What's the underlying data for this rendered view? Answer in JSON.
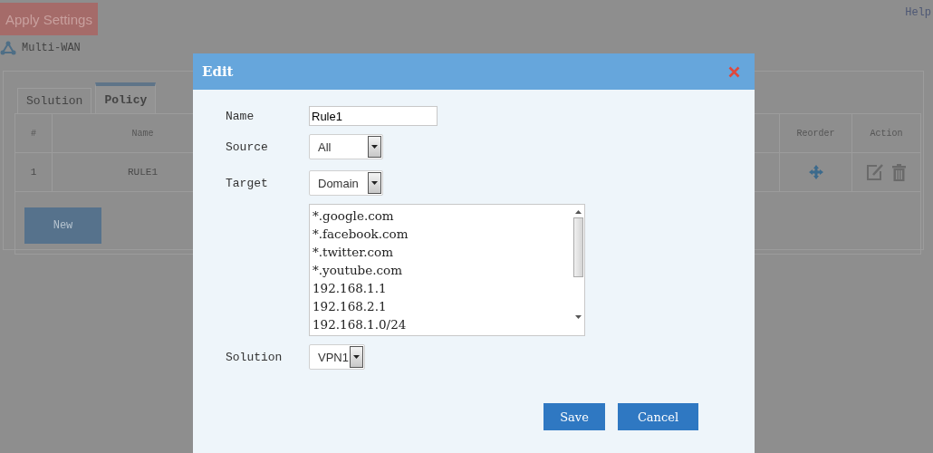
{
  "toolbar": {
    "apply_button": "Apply Settings",
    "help_link": "Help"
  },
  "breadcrumb": "Multi-WAN",
  "tabs": [
    {
      "label": "Solution",
      "selected": false
    },
    {
      "label": "Policy",
      "selected": true
    }
  ],
  "table": {
    "columns": [
      "#",
      "Name",
      "Reorder",
      "Action"
    ],
    "rows": [
      {
        "index": "1",
        "name": "RULE1"
      }
    ]
  },
  "new_button": "New",
  "dialog": {
    "title": "Edit",
    "fields": [
      {
        "kind": "text",
        "label": "Name",
        "value": "Rule1"
      },
      {
        "kind": "select",
        "label": "Source",
        "value": "All"
      },
      {
        "kind": "select",
        "label": "Target",
        "value": "Domain"
      },
      {
        "kind": "list",
        "lines": [
          "*.google.com",
          "*.facebook.com",
          "*.twitter.com",
          "*.youtube.com",
          "192.168.1.1",
          "192.168.2.1",
          "192.168.1.0/24"
        ]
      },
      {
        "kind": "select",
        "label": "Solution",
        "value": "VPN1"
      }
    ],
    "buttons": [
      "Save",
      "Cancel"
    ]
  }
}
